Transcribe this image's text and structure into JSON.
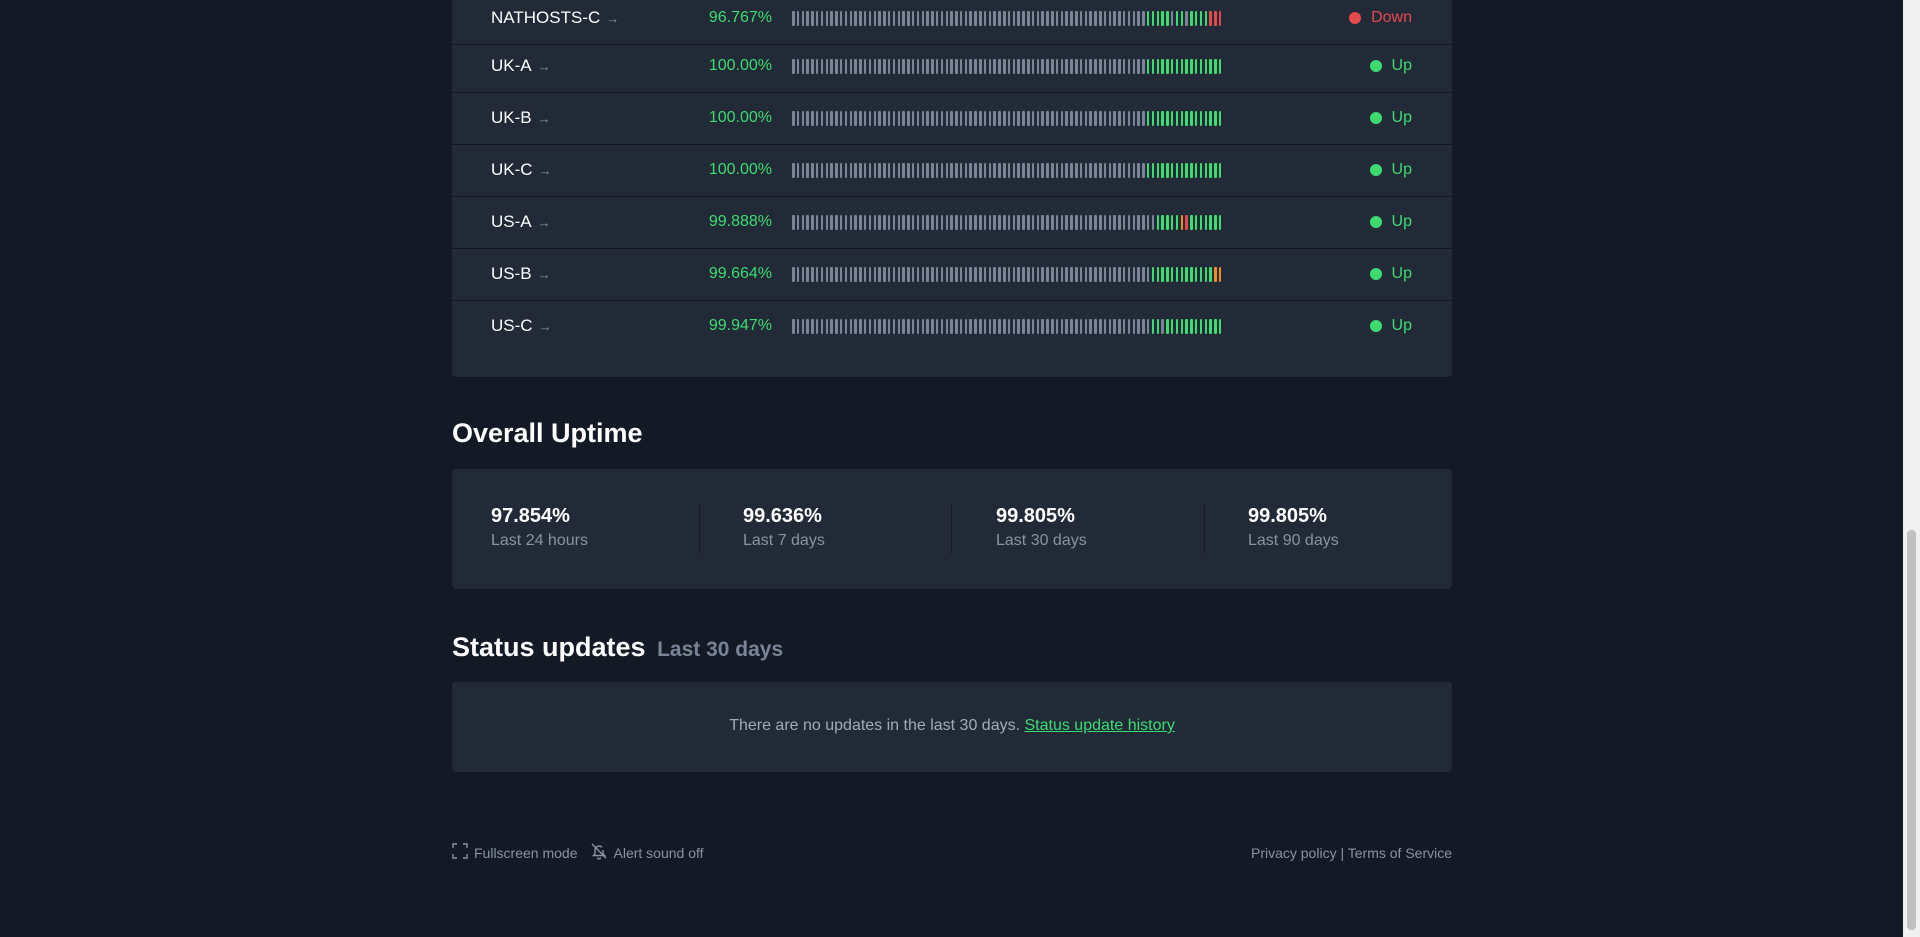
{
  "monitors": [
    {
      "name": "NATHOSTS-C",
      "uptime": "96.767%",
      "status": "Down",
      "status_color": "#e5484d",
      "recent": [
        "g",
        "g",
        "g",
        "g",
        "g",
        "k",
        "g",
        "g",
        "k",
        "g",
        "g",
        "g",
        "g",
        "r",
        "r",
        "r"
      ]
    },
    {
      "name": "UK-A",
      "uptime": "100.00%",
      "status": "Up",
      "status_color": "#3ddc71",
      "recent": [
        "g",
        "g",
        "g",
        "g",
        "g",
        "g",
        "g",
        "g",
        "g",
        "g",
        "g",
        "g",
        "g",
        "g",
        "g",
        "g"
      ]
    },
    {
      "name": "UK-B",
      "uptime": "100.00%",
      "status": "Up",
      "status_color": "#3ddc71",
      "recent": [
        "g",
        "g",
        "g",
        "g",
        "g",
        "g",
        "g",
        "g",
        "g",
        "g",
        "g",
        "g",
        "g",
        "g",
        "g",
        "g"
      ]
    },
    {
      "name": "UK-C",
      "uptime": "100.00%",
      "status": "Up",
      "status_color": "#3ddc71",
      "recent": [
        "g",
        "g",
        "g",
        "g",
        "g",
        "g",
        "g",
        "g",
        "g",
        "g",
        "g",
        "g",
        "g",
        "g",
        "g",
        "g"
      ]
    },
    {
      "name": "US-A",
      "uptime": "99.888%",
      "status": "Up",
      "status_color": "#3ddc71",
      "recent": [
        "k",
        "k",
        "g",
        "g",
        "g",
        "g",
        "g",
        "o",
        "r",
        "g",
        "g",
        "g",
        "g",
        "g",
        "g",
        "g"
      ]
    },
    {
      "name": "US-B",
      "uptime": "99.664%",
      "status": "Up",
      "status_color": "#3ddc71",
      "recent": [
        "k",
        "g",
        "g",
        "g",
        "g",
        "g",
        "g",
        "g",
        "g",
        "g",
        "g",
        "g",
        "g",
        "g",
        "o",
        "o"
      ]
    },
    {
      "name": "US-C",
      "uptime": "99.947%",
      "status": "Up",
      "status_color": "#3ddc71",
      "recent": [
        "k",
        "g",
        "g",
        "k",
        "g",
        "g",
        "g",
        "g",
        "g",
        "g",
        "g",
        "g",
        "g",
        "g",
        "g",
        "g"
      ]
    }
  ],
  "bar_colors": {
    "g": "#3ddc71",
    "k": "#7b8496",
    "r": "#e5484d",
    "o": "#f08c2a"
  },
  "overall": {
    "title": "Overall Uptime",
    "stats": [
      {
        "value": "97.854%",
        "label": "Last 24 hours"
      },
      {
        "value": "99.636%",
        "label": "Last 7 days"
      },
      {
        "value": "99.805%",
        "label": "Last 30 days"
      },
      {
        "value": "99.805%",
        "label": "Last 90 days"
      }
    ]
  },
  "updates": {
    "title": "Status updates",
    "subtitle": "Last 30 days",
    "message": "There are no updates in the last 30 days.",
    "history_link": "Status update history"
  },
  "footer": {
    "fullscreen": "Fullscreen mode",
    "alert": "Alert sound off",
    "privacy": "Privacy policy",
    "separator": "|",
    "terms": "Terms of Service"
  }
}
